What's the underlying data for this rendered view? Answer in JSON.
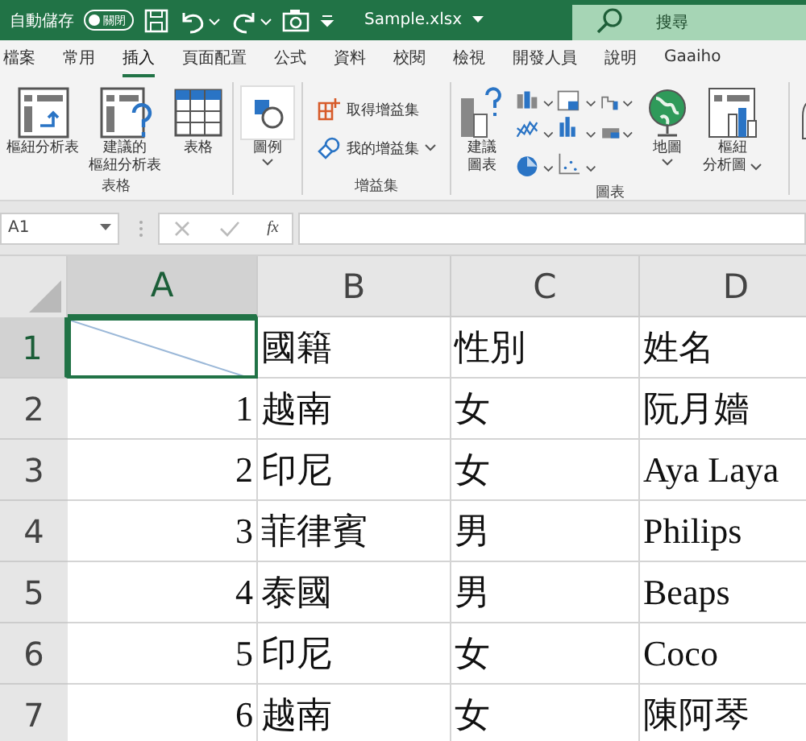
{
  "title_bar": {
    "autosave_label": "自動儲存",
    "autosave_toggle": {
      "label": "關閉",
      "on": false
    },
    "file_name": "Sample.xlsx",
    "search": {
      "placeholder": "搜尋"
    }
  },
  "tabs": [
    {
      "label": "檔案",
      "selected": false
    },
    {
      "label": "常用",
      "selected": false
    },
    {
      "label": "插入",
      "selected": true
    },
    {
      "label": "頁面配置",
      "selected": false
    },
    {
      "label": "公式",
      "selected": false
    },
    {
      "label": "資料",
      "selected": false
    },
    {
      "label": "校閱",
      "selected": false
    },
    {
      "label": "檢視",
      "selected": false
    },
    {
      "label": "開發人員",
      "selected": false
    },
    {
      "label": "說明",
      "selected": false
    },
    {
      "label": "Gaaiho",
      "selected": false
    }
  ],
  "ribbon": {
    "table_group": {
      "label": "表格",
      "buttons": [
        [
          "樞紐分析表"
        ],
        [
          "建議的",
          "樞紐分析表"
        ],
        [
          "表格"
        ]
      ]
    },
    "illustrations": {
      "button": "圖例"
    },
    "addins_group": {
      "label": "增益集",
      "buttons": [
        "取得增益集",
        "我的增益集"
      ]
    },
    "charts_group": {
      "label": "圖表",
      "recommended": [
        "建議",
        "圖表"
      ],
      "map": "地圖",
      "pivot_chart": [
        "樞紐",
        "分析圖"
      ]
    }
  },
  "formula_bar": {
    "name_box": "A1",
    "fx": "fx"
  },
  "grid": {
    "columns": [
      {
        "label": "A",
        "selected": true
      },
      {
        "label": "B",
        "selected": false
      },
      {
        "label": "C",
        "selected": false
      },
      {
        "label": "D",
        "selected": false
      }
    ],
    "rows": [
      {
        "number": "1",
        "selected": true,
        "cells": [
          {
            "kind": "diagonal"
          },
          {
            "kind": "text",
            "text": "國籍"
          },
          {
            "kind": "text",
            "text": "性別"
          },
          {
            "kind": "text",
            "text": "姓名"
          }
        ]
      },
      {
        "number": "2",
        "selected": false,
        "cells": [
          {
            "kind": "number",
            "text": "1"
          },
          {
            "kind": "text",
            "text": "越南"
          },
          {
            "kind": "text",
            "text": "女"
          },
          {
            "kind": "text",
            "text": "阮月嬙"
          }
        ]
      },
      {
        "number": "3",
        "selected": false,
        "cells": [
          {
            "kind": "number",
            "text": "2"
          },
          {
            "kind": "text",
            "text": "印尼"
          },
          {
            "kind": "text",
            "text": "女"
          },
          {
            "kind": "text",
            "text": "Aya Laya"
          }
        ]
      },
      {
        "number": "4",
        "selected": false,
        "cells": [
          {
            "kind": "number",
            "text": "3"
          },
          {
            "kind": "text",
            "text": "菲律賓"
          },
          {
            "kind": "text",
            "text": "男"
          },
          {
            "kind": "text",
            "text": "Philips"
          }
        ]
      },
      {
        "number": "5",
        "selected": false,
        "cells": [
          {
            "kind": "number",
            "text": "4"
          },
          {
            "kind": "text",
            "text": "泰國"
          },
          {
            "kind": "text",
            "text": "男"
          },
          {
            "kind": "text",
            "text": "Beaps"
          }
        ]
      },
      {
        "number": "6",
        "selected": false,
        "cells": [
          {
            "kind": "number",
            "text": "5"
          },
          {
            "kind": "text",
            "text": "印尼"
          },
          {
            "kind": "text",
            "text": "女"
          },
          {
            "kind": "text",
            "text": "Coco"
          }
        ]
      },
      {
        "number": "7",
        "selected": false,
        "cells": [
          {
            "kind": "number",
            "text": "6"
          },
          {
            "kind": "text",
            "text": "越南"
          },
          {
            "kind": "text",
            "text": "女"
          },
          {
            "kind": "text",
            "text": "陳阿琴"
          }
        ]
      }
    ]
  }
}
